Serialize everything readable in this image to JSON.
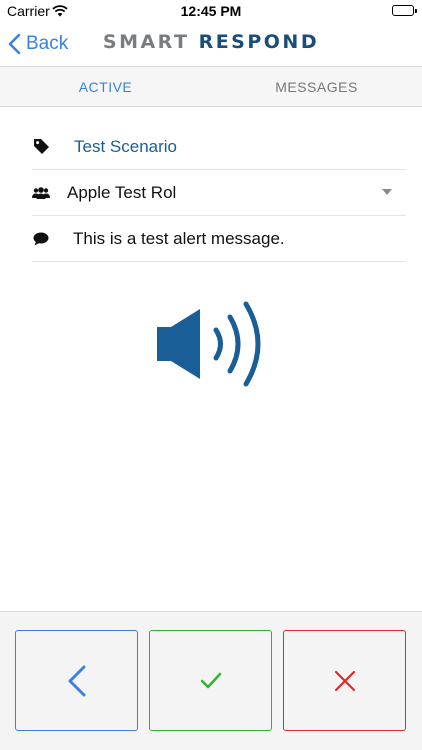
{
  "status_bar": {
    "carrier": "Carrier",
    "time": "12:45 PM",
    "wifi_icon": "wifi-icon",
    "battery_level": 1.0
  },
  "nav": {
    "back_label": "Back",
    "logo_word1": "SMART",
    "logo_word2": "RESPOND"
  },
  "tabs": [
    {
      "label": "ACTIVE",
      "selected": true
    },
    {
      "label": "MESSAGES",
      "selected": false
    }
  ],
  "alert": {
    "scenario": "Test Scenario",
    "role": "Apple Test Rol",
    "message": "This is a test alert message."
  },
  "icons": {
    "scenario": "tag-icon",
    "role": "group-icon",
    "message": "speech-bubble-icon",
    "audio": "speaker-volume-icon",
    "back_action": "chevron-left-icon",
    "accept_action": "checkmark-icon",
    "decline_action": "close-icon"
  },
  "colors": {
    "accent_blue": "#3b82e0",
    "brand_blue": "#1a5e97",
    "accept_green": "#2fb52f",
    "decline_red": "#e02a2a"
  }
}
